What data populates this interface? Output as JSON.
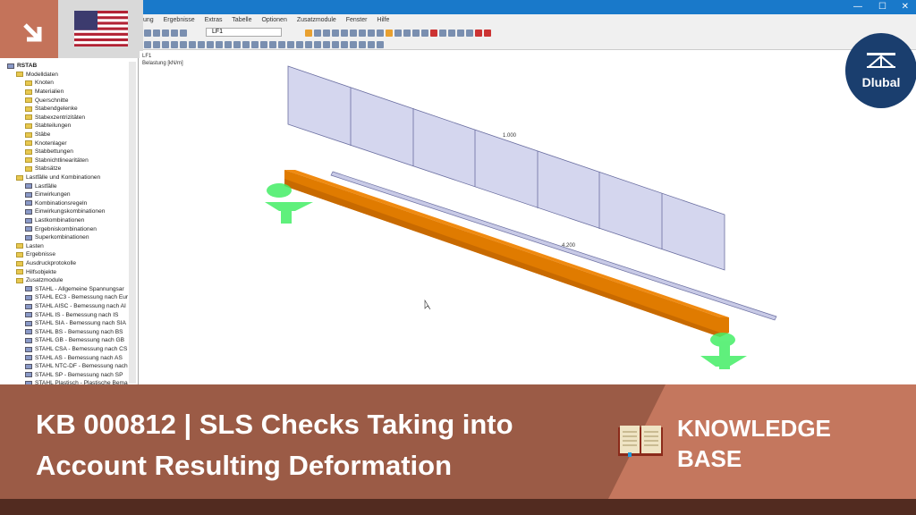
{
  "window": {
    "minimize": "—",
    "maximize": "☐",
    "close": "✕"
  },
  "menu": [
    "ung",
    "Ergebnisse",
    "Extras",
    "Tabelle",
    "Optionen",
    "Zusatzmodule",
    "Fenster",
    "Hilfe"
  ],
  "toolbar": {
    "loadcase": "LF1"
  },
  "viewport": {
    "case": "LF1",
    "unit": "Belastung [kN/m]",
    "load_value": "1.000",
    "member_value": "4.200"
  },
  "tree": [
    {
      "l": 0,
      "t": "RSTAB",
      "f": "m"
    },
    {
      "l": 1,
      "t": "Modelldaten"
    },
    {
      "l": 2,
      "t": "Knoten"
    },
    {
      "l": 2,
      "t": "Materialien"
    },
    {
      "l": 2,
      "t": "Querschnitte"
    },
    {
      "l": 2,
      "t": "Stabendgelenke"
    },
    {
      "l": 2,
      "t": "Stabexzentrizitäten"
    },
    {
      "l": 2,
      "t": "Stabteilungen"
    },
    {
      "l": 2,
      "t": "Stäbe"
    },
    {
      "l": 2,
      "t": "Knotenlager"
    },
    {
      "l": 2,
      "t": "Stabbettungen"
    },
    {
      "l": 2,
      "t": "Stabnichtlinearitäten"
    },
    {
      "l": 2,
      "t": "Stabsätze"
    },
    {
      "l": 1,
      "t": "Lastfälle und Kombinationen"
    },
    {
      "l": 2,
      "t": "Lastfälle",
      "f": "m"
    },
    {
      "l": 2,
      "t": "Einwirkungen",
      "f": "m"
    },
    {
      "l": 2,
      "t": "Kombinationsregeln",
      "f": "m"
    },
    {
      "l": 2,
      "t": "Einwirkungskombinationen",
      "f": "m"
    },
    {
      "l": 2,
      "t": "Lastkombinationen",
      "f": "m"
    },
    {
      "l": 2,
      "t": "Ergebniskombinationen",
      "f": "m"
    },
    {
      "l": 2,
      "t": "Superkombinationen",
      "f": "m"
    },
    {
      "l": 1,
      "t": "Lasten"
    },
    {
      "l": 1,
      "t": "Ergebnisse"
    },
    {
      "l": 1,
      "t": "Ausdruckprotokolle"
    },
    {
      "l": 1,
      "t": "Hilfsobjekte"
    },
    {
      "l": 1,
      "t": "Zusatzmodule"
    },
    {
      "l": 2,
      "t": "STAHL - Allgemeine Spannungsar",
      "f": "m"
    },
    {
      "l": 2,
      "t": "STAHL EC3 - Bemessung nach Eur",
      "f": "m"
    },
    {
      "l": 2,
      "t": "STAHL AISC - Bemessung nach AI",
      "f": "m"
    },
    {
      "l": 2,
      "t": "STAHL IS - Bemessung nach IS",
      "f": "m"
    },
    {
      "l": 2,
      "t": "STAHL SIA - Bemessung nach SIA",
      "f": "m"
    },
    {
      "l": 2,
      "t": "STAHL BS - Bemessung nach BS",
      "f": "m"
    },
    {
      "l": 2,
      "t": "STAHL GB - Bemessung nach GB",
      "f": "m"
    },
    {
      "l": 2,
      "t": "STAHL CSA - Bemessung nach CS",
      "f": "m"
    },
    {
      "l": 2,
      "t": "STAHL AS - Bemessung nach AS",
      "f": "m"
    },
    {
      "l": 2,
      "t": "STAHL NTC-DF - Bemessung nach",
      "f": "m"
    },
    {
      "l": 2,
      "t": "STAHL SP - Bemessung nach SP",
      "f": "m"
    },
    {
      "l": 2,
      "t": "STAHL Plastisch - Plastische Bema",
      "f": "m"
    }
  ],
  "banner": {
    "line1": "KB 000812 | SLS Checks Taking into",
    "line2": "Account Resulting Deformation",
    "kb1": "KNOWLEDGE",
    "kb2": "BASE"
  },
  "logo": "Dlubal",
  "colors": {
    "accent": "#c4735a",
    "beam": "#e07b00",
    "load": "#d4d6ee",
    "support": "#33dd55"
  }
}
